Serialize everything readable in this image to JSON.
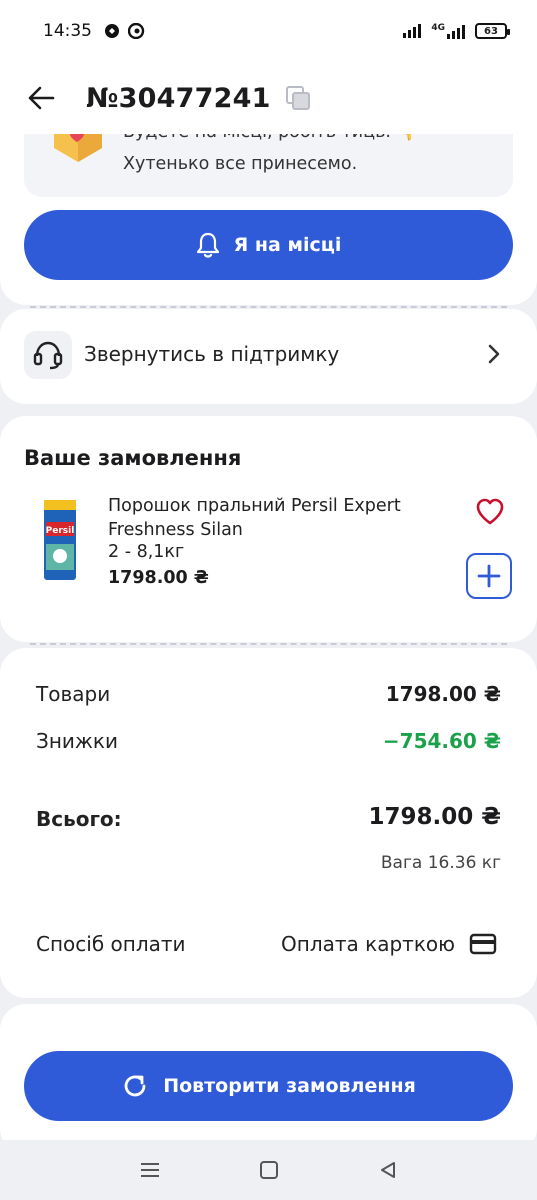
{
  "status_bar": {
    "time": "14:35",
    "network": "4G",
    "battery": "63"
  },
  "header": {
    "order_number": "№30477241"
  },
  "arrival_notice": {
    "line1": "Будете на місці, робіть тиць. 👇",
    "line2": "Хутенько все принесемо.",
    "button_label": "Я на місці"
  },
  "support": {
    "label": "Звернутись в підтримку"
  },
  "order": {
    "heading": "Ваше замовлення",
    "items": [
      {
        "name": "Порошок пральний Persil Expert Freshness Silan",
        "quantity": "2 - 8,1кг",
        "price": "1798.00 ₴"
      }
    ]
  },
  "summary": {
    "goods_label": "Товари",
    "goods_value": "1798.00 ₴",
    "discount_label": "Знижки",
    "discount_value": "−754.60 ₴",
    "total_label": "Всього:",
    "total_value": "1798.00 ₴",
    "weight": "Вага 16.36 кг",
    "payment_label": "Спосіб оплати",
    "payment_value": "Оплата карткою"
  },
  "actions": {
    "repeat_label": "Повторити замовлення"
  },
  "colors": {
    "primary": "#2f5bd8",
    "discount": "#1aa14a",
    "heart": "#c8102e"
  },
  "icons": [
    "back-arrow-icon",
    "copy-icon",
    "bell-icon",
    "headset-icon",
    "chevron-right-icon",
    "heart-icon",
    "plus-icon",
    "credit-card-icon",
    "refresh-icon"
  ]
}
